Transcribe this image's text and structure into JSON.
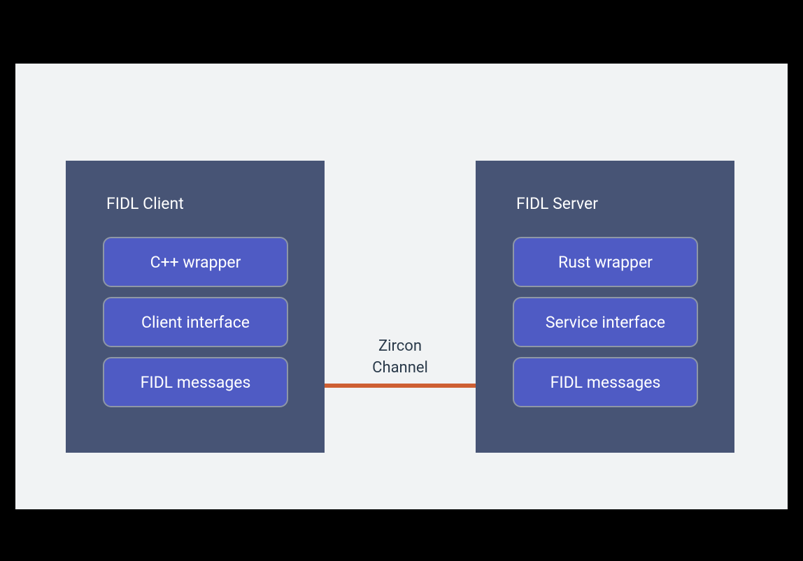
{
  "client": {
    "title": "FIDL Client",
    "blocks": {
      "wrapper": "C++ wrapper",
      "interface": "Client interface",
      "messages": "FIDL messages"
    }
  },
  "server": {
    "title": "FIDL Server",
    "blocks": {
      "wrapper": "Rust wrapper",
      "interface": "Service interface",
      "messages": "FIDL messages"
    }
  },
  "channel": {
    "line1": "Zircon",
    "line2": "Channel"
  }
}
